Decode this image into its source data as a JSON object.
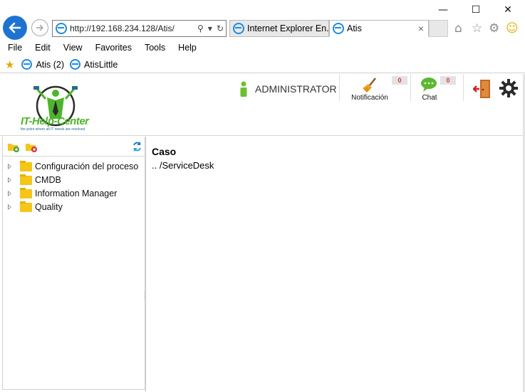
{
  "browser": {
    "address": "http://192.168.234.128/Atis/",
    "tabs": [
      {
        "label": "Internet Explorer En..."
      },
      {
        "label": "Atis",
        "close": "×"
      }
    ],
    "window_controls": {
      "minimize": "—",
      "maximize": "☐",
      "close": "✕"
    }
  },
  "menu": {
    "items": [
      "File",
      "Edit",
      "View",
      "Favorites",
      "Tools",
      "Help"
    ]
  },
  "favorites": {
    "items": [
      "Atis (2)",
      "AtisLittle"
    ]
  },
  "app": {
    "logo": {
      "title": "IT-Help-Center",
      "subtitle": "the point where all IT needs are resolved"
    },
    "user": "ADMINISTRATOR",
    "notifications": {
      "label": "Notificación",
      "count": "0"
    },
    "chat": {
      "label": "Chat",
      "count": "0"
    }
  },
  "tree": {
    "items": [
      "Configuración del proceso",
      "CMDB",
      "Information Manager",
      "Quality"
    ]
  },
  "main": {
    "title": "Caso",
    "path": ".. /ServiceDesk"
  },
  "colors": {
    "back_button": "#1e73d2",
    "logo_green": "#4db52c",
    "folder": "#f5c518",
    "badge_text": "#d43b2a"
  }
}
